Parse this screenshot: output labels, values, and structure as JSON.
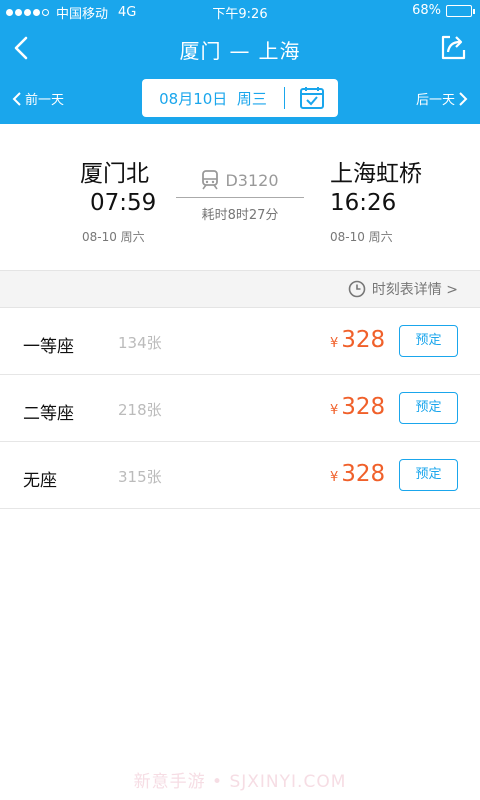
{
  "status": {
    "carrier": "中国移动",
    "network": "4G",
    "time": "下午9:26",
    "battery": "68%",
    "battery_level": 0.68
  },
  "nav": {
    "from": "厦门",
    "separator": "—",
    "to": "上海"
  },
  "datebar": {
    "prev": "前一天",
    "date": "08月10日",
    "weekday": "周三",
    "next": "后一天"
  },
  "train": {
    "from_station": "厦门北",
    "depart_time": "07:59",
    "depart_date": "08-10 周六",
    "number": "D3120",
    "duration": "耗时8时27分",
    "to_station": "上海虹桥",
    "arrive_time": "16:26",
    "arrive_date": "08-10 周六"
  },
  "schedule_link": "时刻表详情 >",
  "seats": [
    {
      "type": "一等座",
      "count": "134张",
      "currency": "¥",
      "price": "328",
      "action": "预定"
    },
    {
      "type": "二等座",
      "count": "218张",
      "currency": "¥",
      "price": "328",
      "action": "预定"
    },
    {
      "type": "无座",
      "count": "315张",
      "currency": "¥",
      "price": "328",
      "action": "预定"
    }
  ],
  "watermark": "新意手游 • SJXINYI.COM",
  "colors": {
    "primary": "#1aa6ec",
    "price": "#f0602a"
  }
}
